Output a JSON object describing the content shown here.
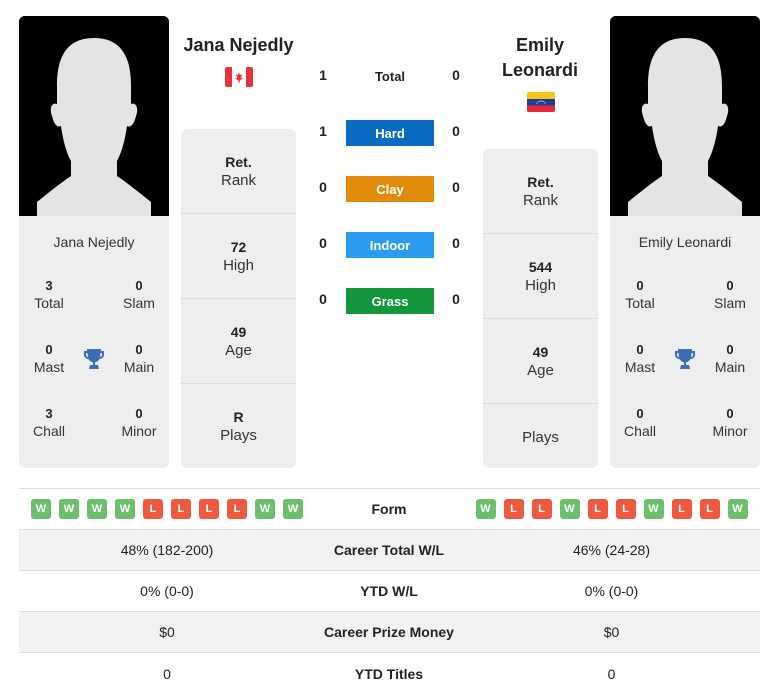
{
  "player1": {
    "name": "Jana Nejedly",
    "flag": "canada-flag",
    "titles": {
      "total": "3",
      "slam": "0",
      "mast": "0",
      "main": "0",
      "chall": "3",
      "minor": "0"
    },
    "labels": {
      "total": "Total",
      "slam": "Slam",
      "mast": "Mast",
      "main": "Main",
      "chall": "Chall",
      "minor": "Minor"
    },
    "rank": {
      "value": "Ret.",
      "label": "Rank"
    },
    "high": {
      "value": "72",
      "label": "High"
    },
    "age": {
      "value": "49",
      "label": "Age"
    },
    "plays": {
      "value": "R",
      "label": "Plays"
    },
    "form": [
      "W",
      "W",
      "W",
      "W",
      "L",
      "L",
      "L",
      "L",
      "W",
      "W"
    ],
    "career_wl": "48% (182-200)",
    "ytd_wl": "0% (0-0)",
    "prize": "$0",
    "ytd_titles": "0"
  },
  "player2": {
    "name_line1": "Emily",
    "name_line2": "Leonardi",
    "name": "Emily Leonardi",
    "flag": "venezuela-flag",
    "titles": {
      "total": "0",
      "slam": "0",
      "mast": "0",
      "main": "0",
      "chall": "0",
      "minor": "0"
    },
    "labels": {
      "total": "Total",
      "slam": "Slam",
      "mast": "Mast",
      "main": "Main",
      "chall": "Chall",
      "minor": "Minor"
    },
    "rank": {
      "value": "Ret.",
      "label": "Rank"
    },
    "high": {
      "value": "544",
      "label": "High"
    },
    "age": {
      "value": "49",
      "label": "Age"
    },
    "plays": {
      "value": "",
      "label": "Plays"
    },
    "form": [
      "W",
      "L",
      "L",
      "W",
      "L",
      "L",
      "W",
      "L",
      "L",
      "W"
    ],
    "career_wl": "46% (24-28)",
    "ytd_wl": "0% (0-0)",
    "prize": "$0",
    "ytd_titles": "0"
  },
  "h2h": {
    "total": {
      "label": "Total",
      "p1": "1",
      "p2": "0"
    },
    "surfaces": [
      {
        "label": "Hard",
        "p1": "1",
        "p2": "0",
        "color": "#0a6bc2"
      },
      {
        "label": "Clay",
        "p1": "0",
        "p2": "0",
        "color": "#e08c0a"
      },
      {
        "label": "Indoor",
        "p1": "0",
        "p2": "0",
        "color": "#2b9cf0"
      },
      {
        "label": "Grass",
        "p1": "0",
        "p2": "0",
        "color": "#12963c"
      }
    ]
  },
  "table": {
    "form_label": "Form",
    "career_label": "Career Total W/L",
    "ytd_label": "YTD W/L",
    "prize_label": "Career Prize Money",
    "titles_label": "YTD Titles"
  },
  "colors": {
    "win": "#6cbf6c",
    "loss": "#ee5a40",
    "trophy": "#3a6fb5",
    "card": "#eeeeee"
  }
}
